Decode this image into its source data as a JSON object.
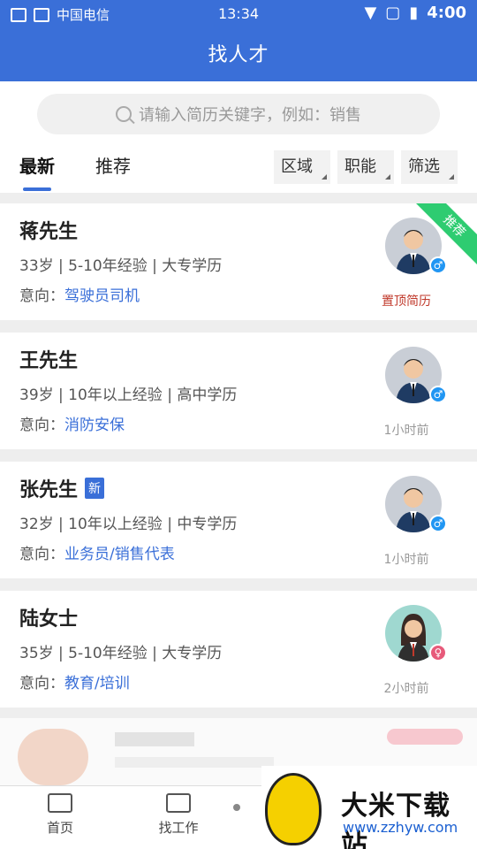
{
  "status_bar": {
    "carrier": "中国电信",
    "time": "13:34",
    "right_text": "4:00"
  },
  "header": {
    "title": "找人才"
  },
  "search": {
    "placeholder": "请输入简历关键字，例如：销售"
  },
  "tabs": [
    {
      "label": "最新",
      "active": true
    },
    {
      "label": "推荐",
      "active": false
    }
  ],
  "filters": [
    {
      "label": "区域"
    },
    {
      "label": "职能"
    },
    {
      "label": "筛选"
    }
  ],
  "candidates": [
    {
      "name": "蒋先生",
      "info": "33岁 | 5-10年经验 | 大专学历",
      "intent_label": "意向：",
      "intent": "驾驶员司机",
      "meta": "置顶简历",
      "gender": "male",
      "ribbon": "推荐",
      "badge": ""
    },
    {
      "name": "王先生",
      "info": "39岁 | 10年以上经验 | 高中学历",
      "intent_label": "意向：",
      "intent": "消防安保",
      "meta": "1小时前",
      "gender": "male",
      "ribbon": "",
      "badge": ""
    },
    {
      "name": "张先生",
      "info": "32岁 | 10年以上经验 | 中专学历",
      "intent_label": "意向：",
      "intent": "业务员/销售代表",
      "meta": "1小时前",
      "gender": "male",
      "ribbon": "",
      "badge": "新"
    },
    {
      "name": "陆女士",
      "info": "35岁 | 5-10年经验 | 大专学历",
      "intent_label": "意向：",
      "intent": "教育/培训",
      "meta": "2小时前",
      "gender": "female",
      "ribbon": "",
      "badge": ""
    }
  ],
  "bottom_nav": [
    {
      "label": "首页",
      "icon": "home-icon"
    },
    {
      "label": "找工作",
      "icon": "briefcase-icon"
    }
  ],
  "watermark": {
    "title": "大米下载站",
    "url": "www.zzhyw.com"
  },
  "colors": {
    "primary": "#3a6fd8",
    "ribbon": "#2ecc71",
    "top_resume": "#c0392b"
  }
}
